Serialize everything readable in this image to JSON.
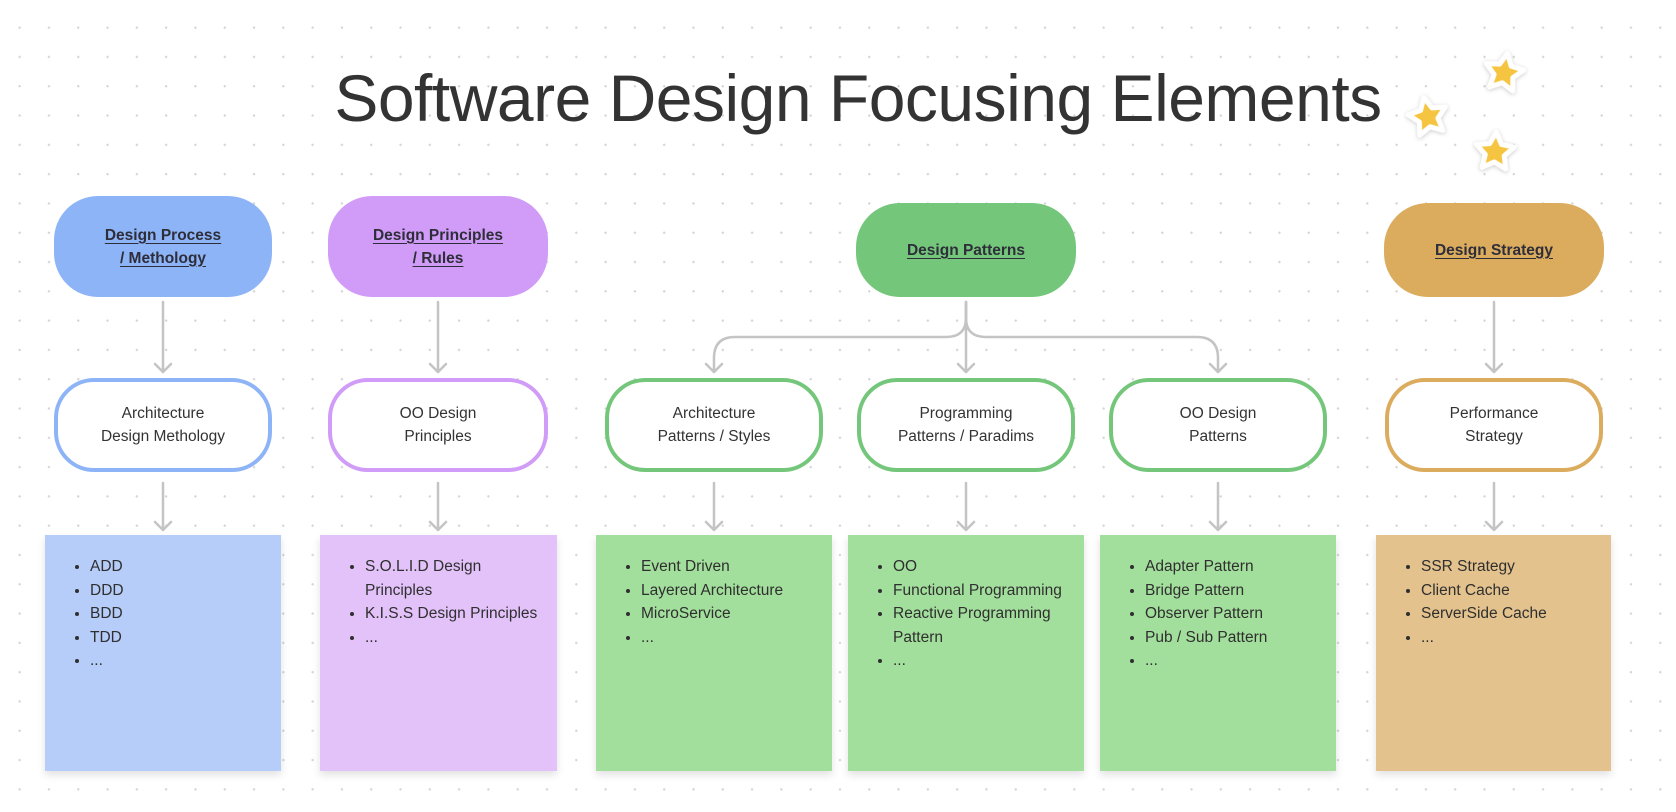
{
  "title": "Software Design Focusing Elements",
  "colors": {
    "blue": "#8eb4f8",
    "blue_light": "#b6cdf9",
    "purple": "#d09cf7",
    "purple_light": "#e2c2f9",
    "green": "#74c77a",
    "green_light": "#a3df9c",
    "orange": "#dcac5e",
    "orange_light": "#e3c28d",
    "connector": "#c4c4c4",
    "star": "#f5c542"
  },
  "categories": [
    {
      "heading": "Design Process\n/ Methology",
      "children": [
        {
          "label": "Architecture\nDesign Methology",
          "items": [
            "ADD",
            "DDD",
            "BDD",
            "TDD",
            "..."
          ]
        }
      ]
    },
    {
      "heading": "Design Principles\n/ Rules",
      "children": [
        {
          "label": "OO Design\nPrinciples",
          "items": [
            "S.O.L.I.D Design Principles",
            "K.I.S.S Design Principles",
            "..."
          ]
        }
      ]
    },
    {
      "heading": "Design Patterns",
      "children": [
        {
          "label": "Architecture\nPatterns / Styles",
          "items": [
            "Event Driven",
            "Layered Architecture",
            "MicroService",
            "..."
          ]
        },
        {
          "label": "Programming\nPatterns / Paradims",
          "items": [
            "OO",
            "Functional Programming",
            "Reactive Programming Pattern",
            "..."
          ]
        },
        {
          "label": "OO Design\nPatterns",
          "items": [
            "Adapter Pattern",
            "Bridge Pattern",
            "Observer Pattern",
            "Pub / Sub Pattern",
            "..."
          ]
        }
      ]
    },
    {
      "heading": "Design Strategy",
      "children": [
        {
          "label": "Performance\nStrategy",
          "items": [
            "SSR Strategy",
            "Client Cache",
            "ServerSide Cache",
            "..."
          ]
        }
      ]
    }
  ],
  "decorations": {
    "stars": 3,
    "star_icon": "star-icon"
  }
}
